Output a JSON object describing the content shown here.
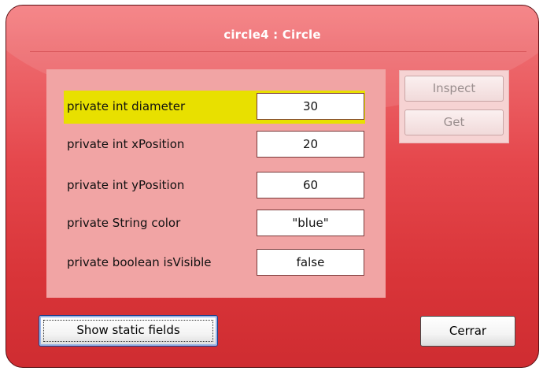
{
  "window": {
    "title": "circle4 : Circle"
  },
  "fields": [
    {
      "label": "private int diameter",
      "value": "30",
      "selected": true
    },
    {
      "label": "private int xPosition",
      "value": "20",
      "selected": false
    },
    {
      "label": "private int yPosition",
      "value": "60",
      "selected": false
    },
    {
      "label": "private String color",
      "value": "\"blue\"",
      "selected": false
    },
    {
      "label": "private boolean isVisible",
      "value": "false",
      "selected": false
    }
  ],
  "side_buttons": {
    "inspect_label": "Inspect",
    "get_label": "Get",
    "enabled": false
  },
  "footer": {
    "show_static_label": "Show static fields",
    "close_label": "Cerrar"
  },
  "colors": {
    "window_red": "#e5474c",
    "panel_pink": "#f1a4a4",
    "selection_yellow": "#e8e000"
  }
}
